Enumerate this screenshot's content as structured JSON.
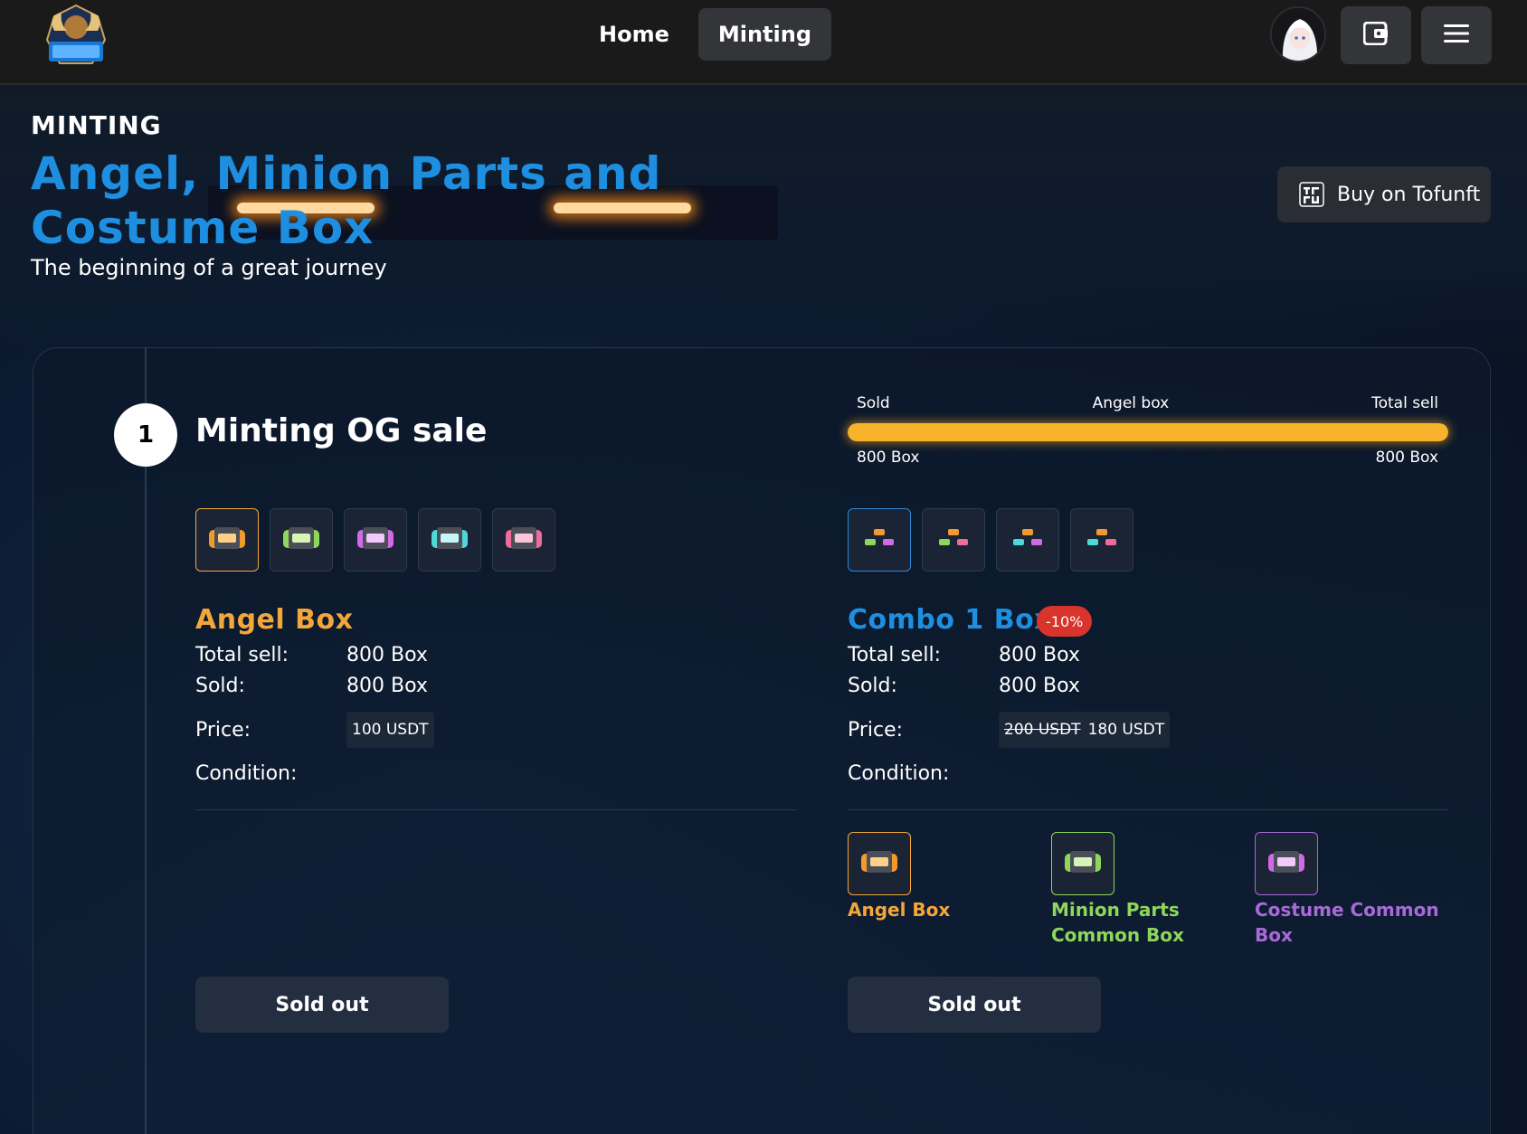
{
  "colors": {
    "brand_blue": "#1e8fe0",
    "angel_orange": "#f4a63a",
    "minion_green": "#8fd65c",
    "costume_purple": "#a86ad8",
    "progress_yellow": "#f7b32b",
    "badge_red": "#d9342b"
  },
  "nav": {
    "home_label": "Home",
    "minting_label": "Minting",
    "wallet_icon": "wallet-icon",
    "menu_icon": "hamburger-menu-icon"
  },
  "hero": {
    "eyebrow": "MINTING",
    "title": "Angel, Minion Parts and Costume Box",
    "subtitle": "The beginning of a great journey",
    "buy_label": "Buy on Tofunft",
    "buy_logo_text": "TOZ\nFU"
  },
  "step": {
    "number": "1",
    "title": "Minting OG sale"
  },
  "progress": {
    "label_left": "Sold",
    "label_center": "Angel box",
    "label_right": "Total sell",
    "sold_value": "800 Box",
    "total_value": "800 Box",
    "fraction": 1.0
  },
  "angel_box": {
    "name": "Angel Box",
    "total_sell_label": "Total sell:",
    "total_sell_value": "800 Box",
    "sold_label": "Sold:",
    "sold_value": "800 Box",
    "price_label": "Price:",
    "price_value": "100 USDT",
    "condition_label": "Condition:",
    "button_label": "Sold out"
  },
  "combo_box": {
    "name": "Combo 1 Box",
    "discount": "-10%",
    "total_sell_label": "Total sell:",
    "total_sell_value": "800 Box",
    "sold_label": "Sold:",
    "sold_value": "800 Box",
    "price_label": "Price:",
    "price_old": "200 USDT",
    "price_new": "180 USDT",
    "condition_label": "Condition:",
    "items": [
      {
        "label": "Angel Box"
      },
      {
        "label": "Minion Parts Common Box"
      },
      {
        "label": "Costume Common Box"
      }
    ],
    "button_label": "Sold out"
  }
}
